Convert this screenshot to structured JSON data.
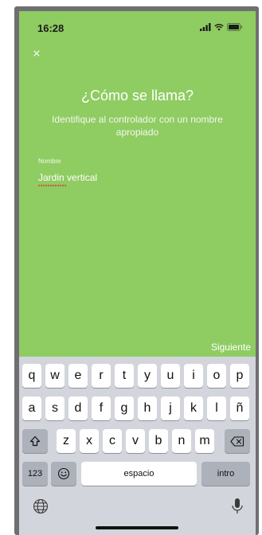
{
  "status_bar": {
    "time": "16:28",
    "icons": [
      "signal-icon",
      "wifi-icon",
      "battery-icon"
    ]
  },
  "screen": {
    "background_color": "#8fcc62",
    "close_icon": "close-icon",
    "title": "¿Cómo se llama?",
    "subtitle": "Identifique al controlador con un nombre apropiado",
    "name_label": "Nombre",
    "name_value": "Jardin vertical",
    "next_label": "Siguiente"
  },
  "keyboard": {
    "row1": [
      "q",
      "w",
      "e",
      "r",
      "t",
      "y",
      "u",
      "i",
      "o",
      "p"
    ],
    "row2": [
      "a",
      "s",
      "d",
      "f",
      "g",
      "h",
      "j",
      "k",
      "l",
      "ñ"
    ],
    "row3": [
      "z",
      "x",
      "c",
      "v",
      "b",
      "n",
      "m"
    ],
    "shift_icon": "shift-icon",
    "backspace_icon": "backspace-icon",
    "numbers_label": "123",
    "emoji_icon": "emoji-icon",
    "space_label": "espacio",
    "return_label": "intro",
    "globe_icon": "globe-icon",
    "mic_icon": "microphone-icon"
  }
}
